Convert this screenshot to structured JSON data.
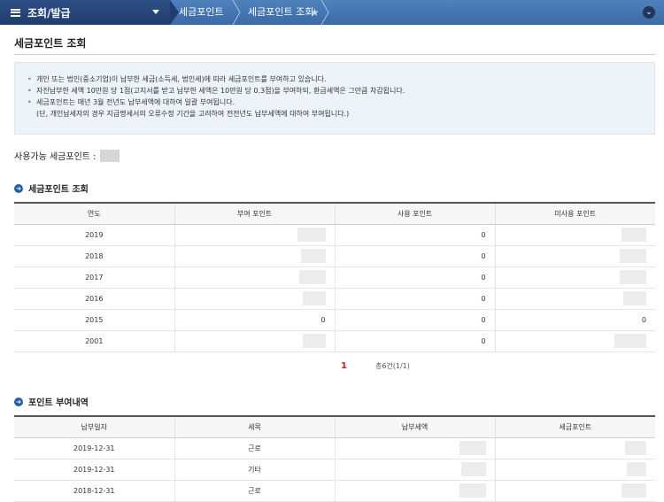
{
  "topbar": {
    "menu_label": "조회/발급",
    "breadcrumbs": [
      "세금포인트",
      "세금포인트 조회"
    ]
  },
  "page": {
    "title": "세금포인트 조회"
  },
  "notice": {
    "line1": "개인 또는 법인(중소기업)이 납부한 세금(소득세, 법인세)에 따라 세금포인트를 부여하고 있습니다.",
    "line2": "자진납부한 세액 10만원 당 1점(고지서를 받고 납부한 세액은 10만원 당 0.3점)을 부여하되, 환급세액은 그만큼 차감됩니다.",
    "line3": "세금포인트는 매년 3월 전년도 납부세액에 대하여 일괄 부여됩니다.",
    "line4": "(단, 개인납세자의 경우 지급명세서의 오류수정 기간을 고려하여 전전년도 납부세액에 대하여 부여됩니다.)"
  },
  "available": {
    "label": "사용가능 세금포인트 :"
  },
  "points_section": {
    "title": "세금포인트 조회",
    "headers": [
      "연도",
      "부여 포인트",
      "사용 포인트",
      "미사용 포인트"
    ],
    "rows": [
      {
        "year": "2019",
        "granted": "",
        "used": "0",
        "unused": ""
      },
      {
        "year": "2018",
        "granted": "",
        "used": "0",
        "unused": ""
      },
      {
        "year": "2017",
        "granted": "",
        "used": "0",
        "unused": ""
      },
      {
        "year": "2016",
        "granted": "",
        "used": "0",
        "unused": ""
      },
      {
        "year": "2015",
        "granted": "0",
        "used": "0",
        "unused": "0"
      },
      {
        "year": "2001",
        "granted": "",
        "used": "0",
        "unused": ""
      }
    ],
    "pager_current": "1",
    "total_text": "총6건(1/1)"
  },
  "grant_section": {
    "title": "포인트 부여내역",
    "headers": [
      "납부일자",
      "세목",
      "납부세액",
      "세금포인트"
    ],
    "rows": [
      {
        "date": "2019-12-31",
        "tax": "근로"
      },
      {
        "date": "2019-12-31",
        "tax": "기타"
      },
      {
        "date": "2018-12-31",
        "tax": "근로"
      }
    ]
  }
}
